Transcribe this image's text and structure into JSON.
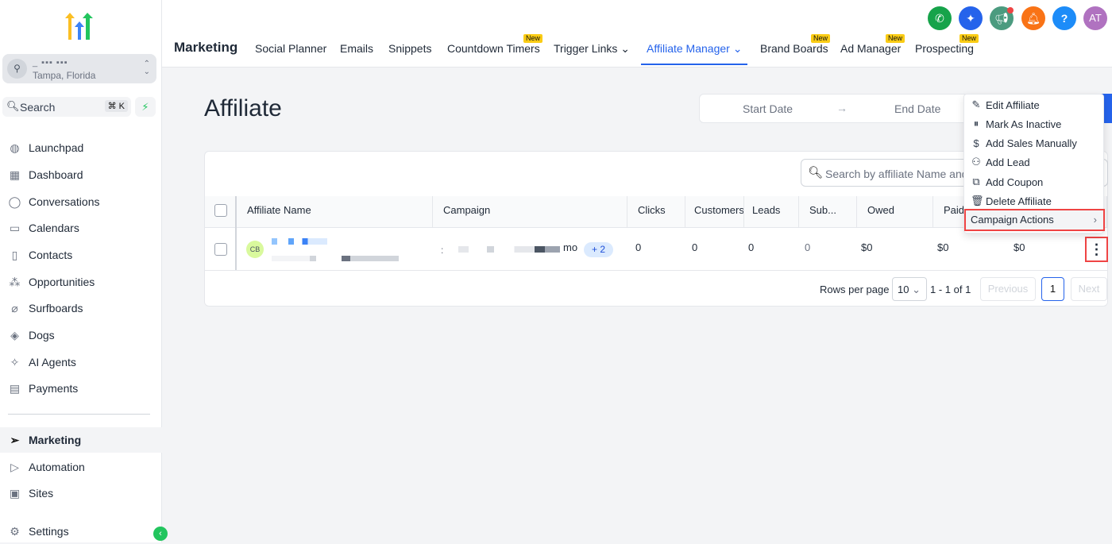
{
  "sidebar": {
    "location": {
      "name": "_ ▪▪▪ ▪▪▪",
      "city": "Tampa, Florida"
    },
    "search_label": "Search",
    "search_shortcut": "⌘ K",
    "items": [
      {
        "label": "Launchpad"
      },
      {
        "label": "Dashboard"
      },
      {
        "label": "Conversations"
      },
      {
        "label": "Calendars"
      },
      {
        "label": "Contacts"
      },
      {
        "label": "Opportunities"
      },
      {
        "label": "Surfboards"
      },
      {
        "label": "Dogs"
      },
      {
        "label": "AI Agents"
      },
      {
        "label": "Payments"
      }
    ],
    "bottom_items": [
      {
        "label": "Marketing"
      },
      {
        "label": "Automation"
      },
      {
        "label": "Sites"
      },
      {
        "label": "Settings"
      }
    ]
  },
  "header": {
    "title": "Marketing",
    "new_badge": "New",
    "tabs": [
      {
        "label": "Social Planner"
      },
      {
        "label": "Emails"
      },
      {
        "label": "Snippets"
      },
      {
        "label": "Countdown Timers"
      },
      {
        "label": "Trigger Links"
      },
      {
        "label": "Affiliate Manager"
      },
      {
        "label": "Brand Boards"
      },
      {
        "label": "Ad Manager"
      },
      {
        "label": "Prospecting"
      }
    ],
    "avatar": "AT",
    "help": "?"
  },
  "page": {
    "title": "Affiliate",
    "start_date": "Start Date",
    "end_date": "End Date",
    "search_placeholder": "Search by affiliate Name and"
  },
  "table": {
    "columns": [
      "Affiliate Name",
      "Campaign",
      "Clicks",
      "Customers",
      "Leads",
      "Sub...",
      "Owed",
      "Paid"
    ],
    "rows": [
      {
        "initials": "CB",
        "campaign_suffix": "mo",
        "extra": "+ 2",
        "clicks": "0",
        "customers": "0",
        "leads": "0",
        "sub": "0",
        "owed": "$0",
        "paid": "$0",
        "last": "$0"
      }
    ]
  },
  "pagination": {
    "rows_label": "Rows per page",
    "rows_value": "10",
    "range": "1 - 1 of 1",
    "prev": "Previous",
    "page": "1",
    "next": "Next"
  },
  "menu": {
    "items": [
      "Edit Affiliate",
      "Mark As Inactive",
      "Add Sales Manually",
      "Add Lead",
      "Add Coupon",
      "Delete Affiliate"
    ],
    "campaign_actions": "Campaign Actions"
  }
}
